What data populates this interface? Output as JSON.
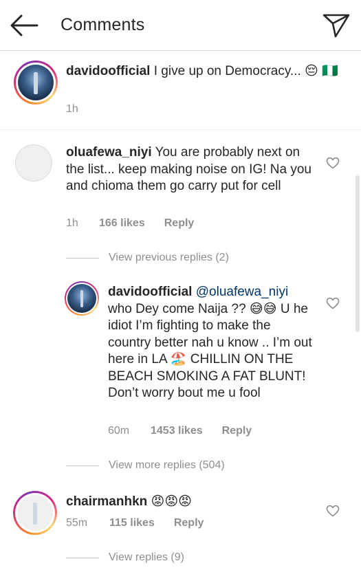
{
  "header": {
    "title": "Comments",
    "back_icon": "arrow-left-icon",
    "send_icon": "paper-plane-icon"
  },
  "caption": {
    "username": "davidoofficial",
    "text": " I give up on Democracy... 😔 🇳🇬",
    "time": "1h"
  },
  "comments": [
    {
      "username": "oluafewa_niyi",
      "text": " You are probably next on the list... keep making noise on IG! Na you and chioma them go carry put for cell",
      "time": "1h",
      "likes": "166 likes",
      "reply_label": "Reply",
      "view_replies": "View previous replies (2)",
      "reply": {
        "username": "davidoofficial",
        "mention": " @oluafewa_niyi",
        "text": " who Dey come Naija ?? 😅😅 U he idiot I’m fighting to make the country better nah u know .. I’m out here in LA 🏖️ CHILLIN ON THE BEACH SMOKING A FAT BLUNT! Don’t worry bout me u fool",
        "time": "60m",
        "likes": "1453 likes",
        "reply_label": "Reply"
      },
      "view_more_replies": "View more replies (504)"
    },
    {
      "username": "chairmanhkn",
      "text": " 😡😡😡",
      "time": "55m",
      "likes": "115 likes",
      "reply_label": "Reply",
      "view_replies": "View replies (9)"
    }
  ]
}
